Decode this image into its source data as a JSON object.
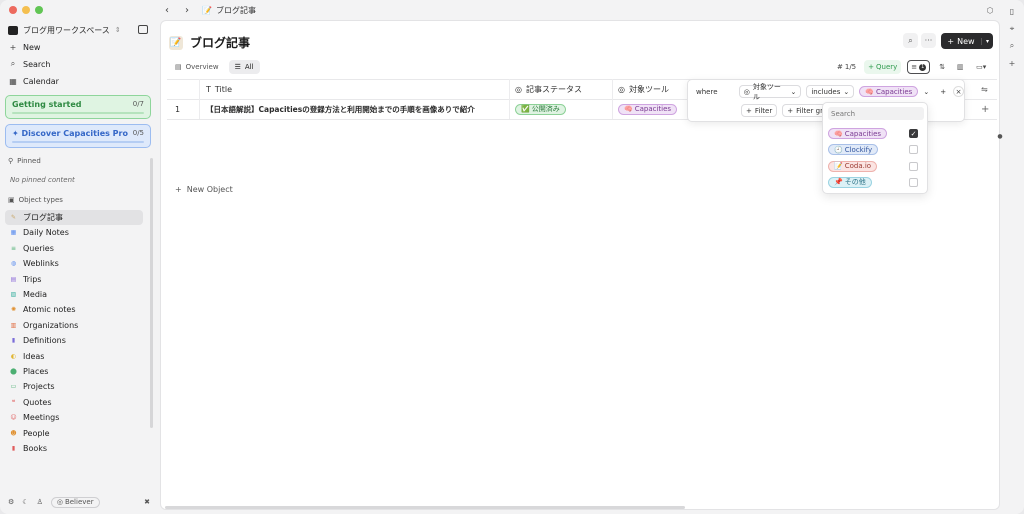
{
  "topbar": {
    "breadcrumb": "ブログ記事",
    "back": "‹",
    "forward": "›"
  },
  "sidebar": {
    "workspace": "ブログ用ワークスペース",
    "new_label": "New",
    "search_label": "Search",
    "calendar_label": "Calendar",
    "getting_started": {
      "title": "Getting started",
      "count": "0/7"
    },
    "discover": {
      "title": "Discover Capacities Pro",
      "count": "0/5"
    },
    "pinned_heading": "Pinned",
    "no_pinned": "No pinned content",
    "object_types_heading": "Object types",
    "types": [
      {
        "label": "ブログ記事",
        "icon": "memo-icon",
        "color": "#c9a86a"
      },
      {
        "label": "Daily Notes",
        "icon": "calendar-icon",
        "color": "#5b8def"
      },
      {
        "label": "Queries",
        "icon": "list-icon",
        "color": "#4caf72"
      },
      {
        "label": "Weblinks",
        "icon": "globe-icon",
        "color": "#5b8def"
      },
      {
        "label": "Trips",
        "icon": "suitcase-icon",
        "color": "#8e6cd8"
      },
      {
        "label": "Media",
        "icon": "image-icon",
        "color": "#3fb2a2"
      },
      {
        "label": "Atomic notes",
        "icon": "atom-icon",
        "color": "#e0902f"
      },
      {
        "label": "Organizations",
        "icon": "building-icon",
        "color": "#e06b3f"
      },
      {
        "label": "Definitions",
        "icon": "book-icon",
        "color": "#7a6cd8"
      },
      {
        "label": "Ideas",
        "icon": "bulb-icon",
        "color": "#e0b52f"
      },
      {
        "label": "Places",
        "icon": "pin-icon",
        "color": "#4caf72"
      },
      {
        "label": "Projects",
        "icon": "folder-icon",
        "color": "#4caf72"
      },
      {
        "label": "Quotes",
        "icon": "quote-icon",
        "color": "#e05b5b"
      },
      {
        "label": "Meetings",
        "icon": "people-icon",
        "color": "#e05b5b"
      },
      {
        "label": "People",
        "icon": "person-icon",
        "color": "#e0902f"
      },
      {
        "label": "Books",
        "icon": "book-icon",
        "color": "#e05b5b"
      }
    ],
    "footer_badge": "Believer"
  },
  "main": {
    "title": "ブログ記事",
    "new_button": "New",
    "tabs": [
      {
        "label": "Overview"
      },
      {
        "label": "All"
      }
    ],
    "toolbar": {
      "count": "1/5",
      "query": "Query",
      "filter_count": "1"
    },
    "table": {
      "columns": [
        "Title",
        "記事ステータス",
        "対象ツール"
      ],
      "rows": [
        {
          "index": "1",
          "title": "【日本語解説】Capacitiesの登録方法と利用開始までの手順を画像ありで紹介",
          "status": "公開済み",
          "tool": "Capacities"
        }
      ],
      "new_object": "New Object"
    }
  },
  "filter": {
    "where": "where",
    "property": "対象ツール",
    "operator": "includes",
    "value": "Capacities",
    "add_filter": "Filter",
    "add_group": "Filter group"
  },
  "dropdown": {
    "search_placeholder": "Search",
    "options": [
      {
        "label": "Capacities",
        "icon": "🧠",
        "style": "cap",
        "checked": true
      },
      {
        "label": "Clockify",
        "icon": "🕘",
        "style": "clock",
        "checked": false
      },
      {
        "label": "Coda.io",
        "icon": "📝",
        "style": "coda",
        "checked": false
      },
      {
        "label": "その他",
        "icon": "📌",
        "style": "other",
        "checked": false
      }
    ]
  }
}
